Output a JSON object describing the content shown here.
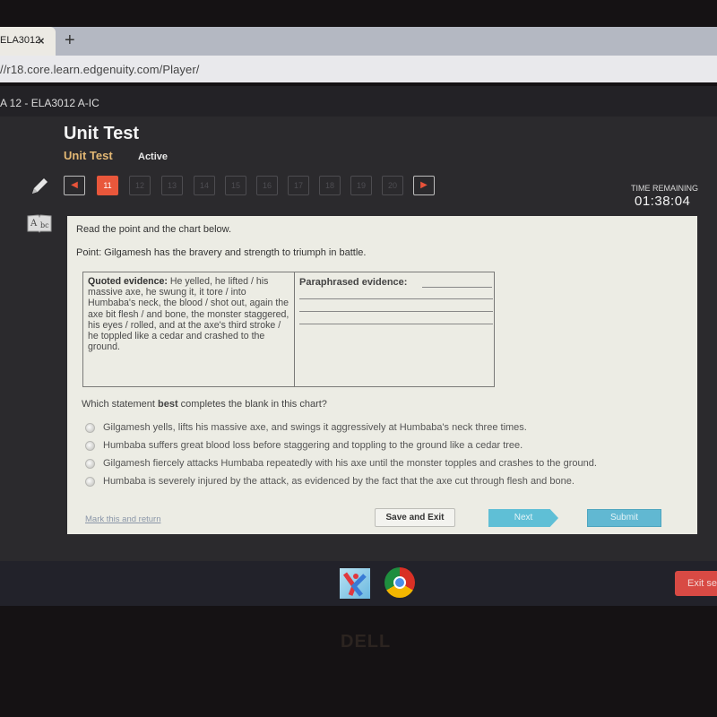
{
  "browser": {
    "tab_title": "ELA3012",
    "tab_close": "×",
    "new_tab": "+",
    "url": "//r18.core.learn.edgenuity.com/Player/"
  },
  "app": {
    "course_title": "A 12 - ELA3012 A-IC",
    "page_title": "Unit Test",
    "sub_title": "Unit Test",
    "status": "Active",
    "tools": [
      "pencil-icon",
      "dictionary-icon"
    ],
    "question_nav": {
      "prev": "◀",
      "next": "▶",
      "current": "11",
      "items": [
        "11",
        "12",
        "13",
        "14",
        "15",
        "16",
        "17",
        "18",
        "19",
        "20"
      ]
    },
    "timer": {
      "label": "TIME REMAINING",
      "value": "01:38:04"
    }
  },
  "content": {
    "instruction": "Read the point and the chart below.",
    "point": "Point: Gilgamesh has the bravery and strength to triumph in battle.",
    "chart": {
      "quoted_label": "Quoted evidence:",
      "quoted_text": "He yelled, he lifted / his massive axe, he swung it, it tore / into Humbaba's neck, the blood / shot out, again the axe bit flesh / and bone, the monster staggered, his eyes / rolled, and at the axe's third stroke / he toppled like a cedar and crashed to the ground.",
      "paraphrased_label": "Paraphrased evidence:"
    },
    "question_prefix": "Which statement ",
    "question_bold": "best",
    "question_suffix": " completes the blank in this chart?",
    "options": [
      "Gilgamesh yells, lifts his massive axe, and swings it aggressively at Humbaba's neck three times.",
      "Humbaba suffers great blood loss before staggering and toppling to the ground like a cedar tree.",
      "Gilgamesh fiercely attacks Humbaba repeatedly with his axe until the monster topples and crashes to the ground.",
      "Humbaba is severely injured by the attack, as evidenced by the fact that the axe cut through flesh and bone."
    ],
    "footer": {
      "mark_link": "Mark this and return",
      "save_exit": "Save and Exit",
      "next": "Next",
      "submit": "Submit"
    }
  },
  "taskbar": {
    "apps": [
      "edgenuity-app-icon",
      "chrome-icon"
    ],
    "exit_button": "Exit ses"
  },
  "bezel": {
    "logo": "DELL"
  },
  "colors": {
    "accent_orange": "#e9573b",
    "subtitle_gold": "#e3b874",
    "button_blue": "#5fbfd6",
    "exit_red": "#d84a44"
  }
}
